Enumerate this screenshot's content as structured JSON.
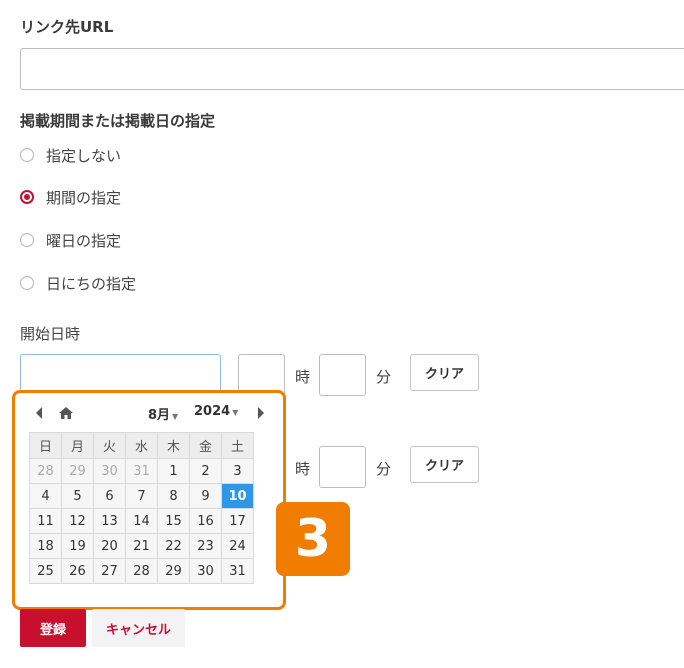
{
  "link": {
    "label": "リンク先URL",
    "value": ""
  },
  "period": {
    "label": "掲載期間または掲載日の指定",
    "options": [
      {
        "label": "指定しない",
        "checked": false
      },
      {
        "label": "期間の指定",
        "checked": true
      },
      {
        "label": "曜日の指定",
        "checked": false
      },
      {
        "label": "日にちの指定",
        "checked": false
      }
    ]
  },
  "start": {
    "label": "開始日時",
    "hour_unit": "時",
    "minute_unit": "分",
    "clear_label": "クリア"
  },
  "end": {
    "hour_unit": "時",
    "minute_unit": "分",
    "clear_label": "クリア"
  },
  "calendar": {
    "month": "8月",
    "year": "2024",
    "weekdays": [
      "日",
      "月",
      "火",
      "水",
      "木",
      "金",
      "土"
    ],
    "weeks": [
      [
        "28",
        "29",
        "30",
        "31",
        "1",
        "2",
        "3"
      ],
      [
        "4",
        "5",
        "6",
        "7",
        "8",
        "9",
        "10"
      ],
      [
        "11",
        "12",
        "13",
        "14",
        "15",
        "16",
        "17"
      ],
      [
        "18",
        "19",
        "20",
        "21",
        "22",
        "23",
        "24"
      ],
      [
        "25",
        "26",
        "27",
        "28",
        "29",
        "30",
        "31"
      ]
    ],
    "selected": "10"
  },
  "step_badge": "3",
  "actions": {
    "submit": "登録",
    "cancel": "キャンセル"
  },
  "colors": {
    "accent": "#c8102e",
    "highlight": "#f07d00",
    "today": "#2f98e6"
  }
}
